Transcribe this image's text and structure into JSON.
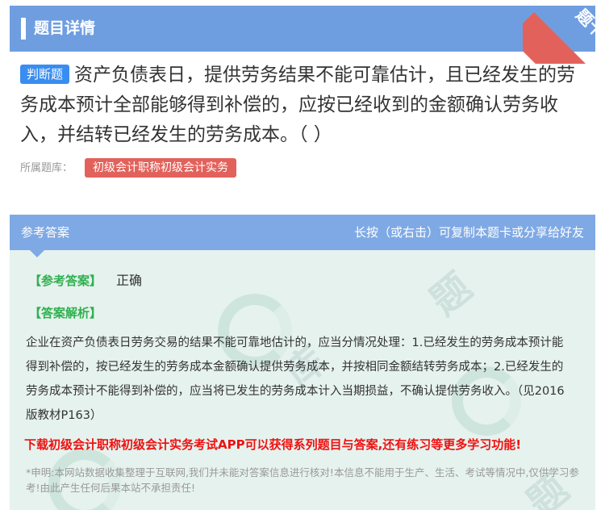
{
  "header": {
    "title": "题目详情",
    "corner_tag": "题卡"
  },
  "question": {
    "type_tag": "判断题",
    "text": "资产负债表日，提供劳务结果不能可靠估计，且已经发生的劳务成本预计全部能够得到补偿的，应按已经收到的金额确认劳务收入，并结转已经发生的劳务成本。（ ）"
  },
  "source": {
    "label": "所属题库：",
    "bank": "初级会计职称初级会计实务"
  },
  "answer": {
    "title": "参考答案",
    "hint": "长按（或右击）可复制本题卡或分享给好友",
    "ref_label": "【参考答案】",
    "ref_value": "正确",
    "analysis_label": "【答案解析】",
    "analysis": "企业在资产负债表日劳务交易的结果不能可靠地估计的，应当分情况处理：1.已经发生的劳务成本预计能得到补偿的，按已经发生的劳务成本金额确认提供劳务成本，并按相同金额结转劳务成本；2.已经发生的劳务成本预计不能得到补偿的，应当将已发生的劳务成本计入当期损益，不确认提供劳务收入。（见2016版教材P163）",
    "promo": "下载初级会计职称初级会计实务考试APP可以获得系列题目与答案,还有练习等更多学习功能!",
    "disclaimer": "*申明:本网站数据收集整理于互联网,我们并未能对答案信息进行核对!本信息不能用于生产、生活、考试等情况中,仅供学习参考!由此产生任何后果本站不承担责任!"
  },
  "colors": {
    "header_bg": "#6f9ee0",
    "answer_head_bg": "#7fa9e4",
    "tag_blue": "#3a8df0",
    "badge_red": "#e2625b",
    "green": "#2fb04f",
    "promo_red": "#ee1111"
  },
  "icons": {
    "watermark": "swirl-logo-watermark"
  }
}
